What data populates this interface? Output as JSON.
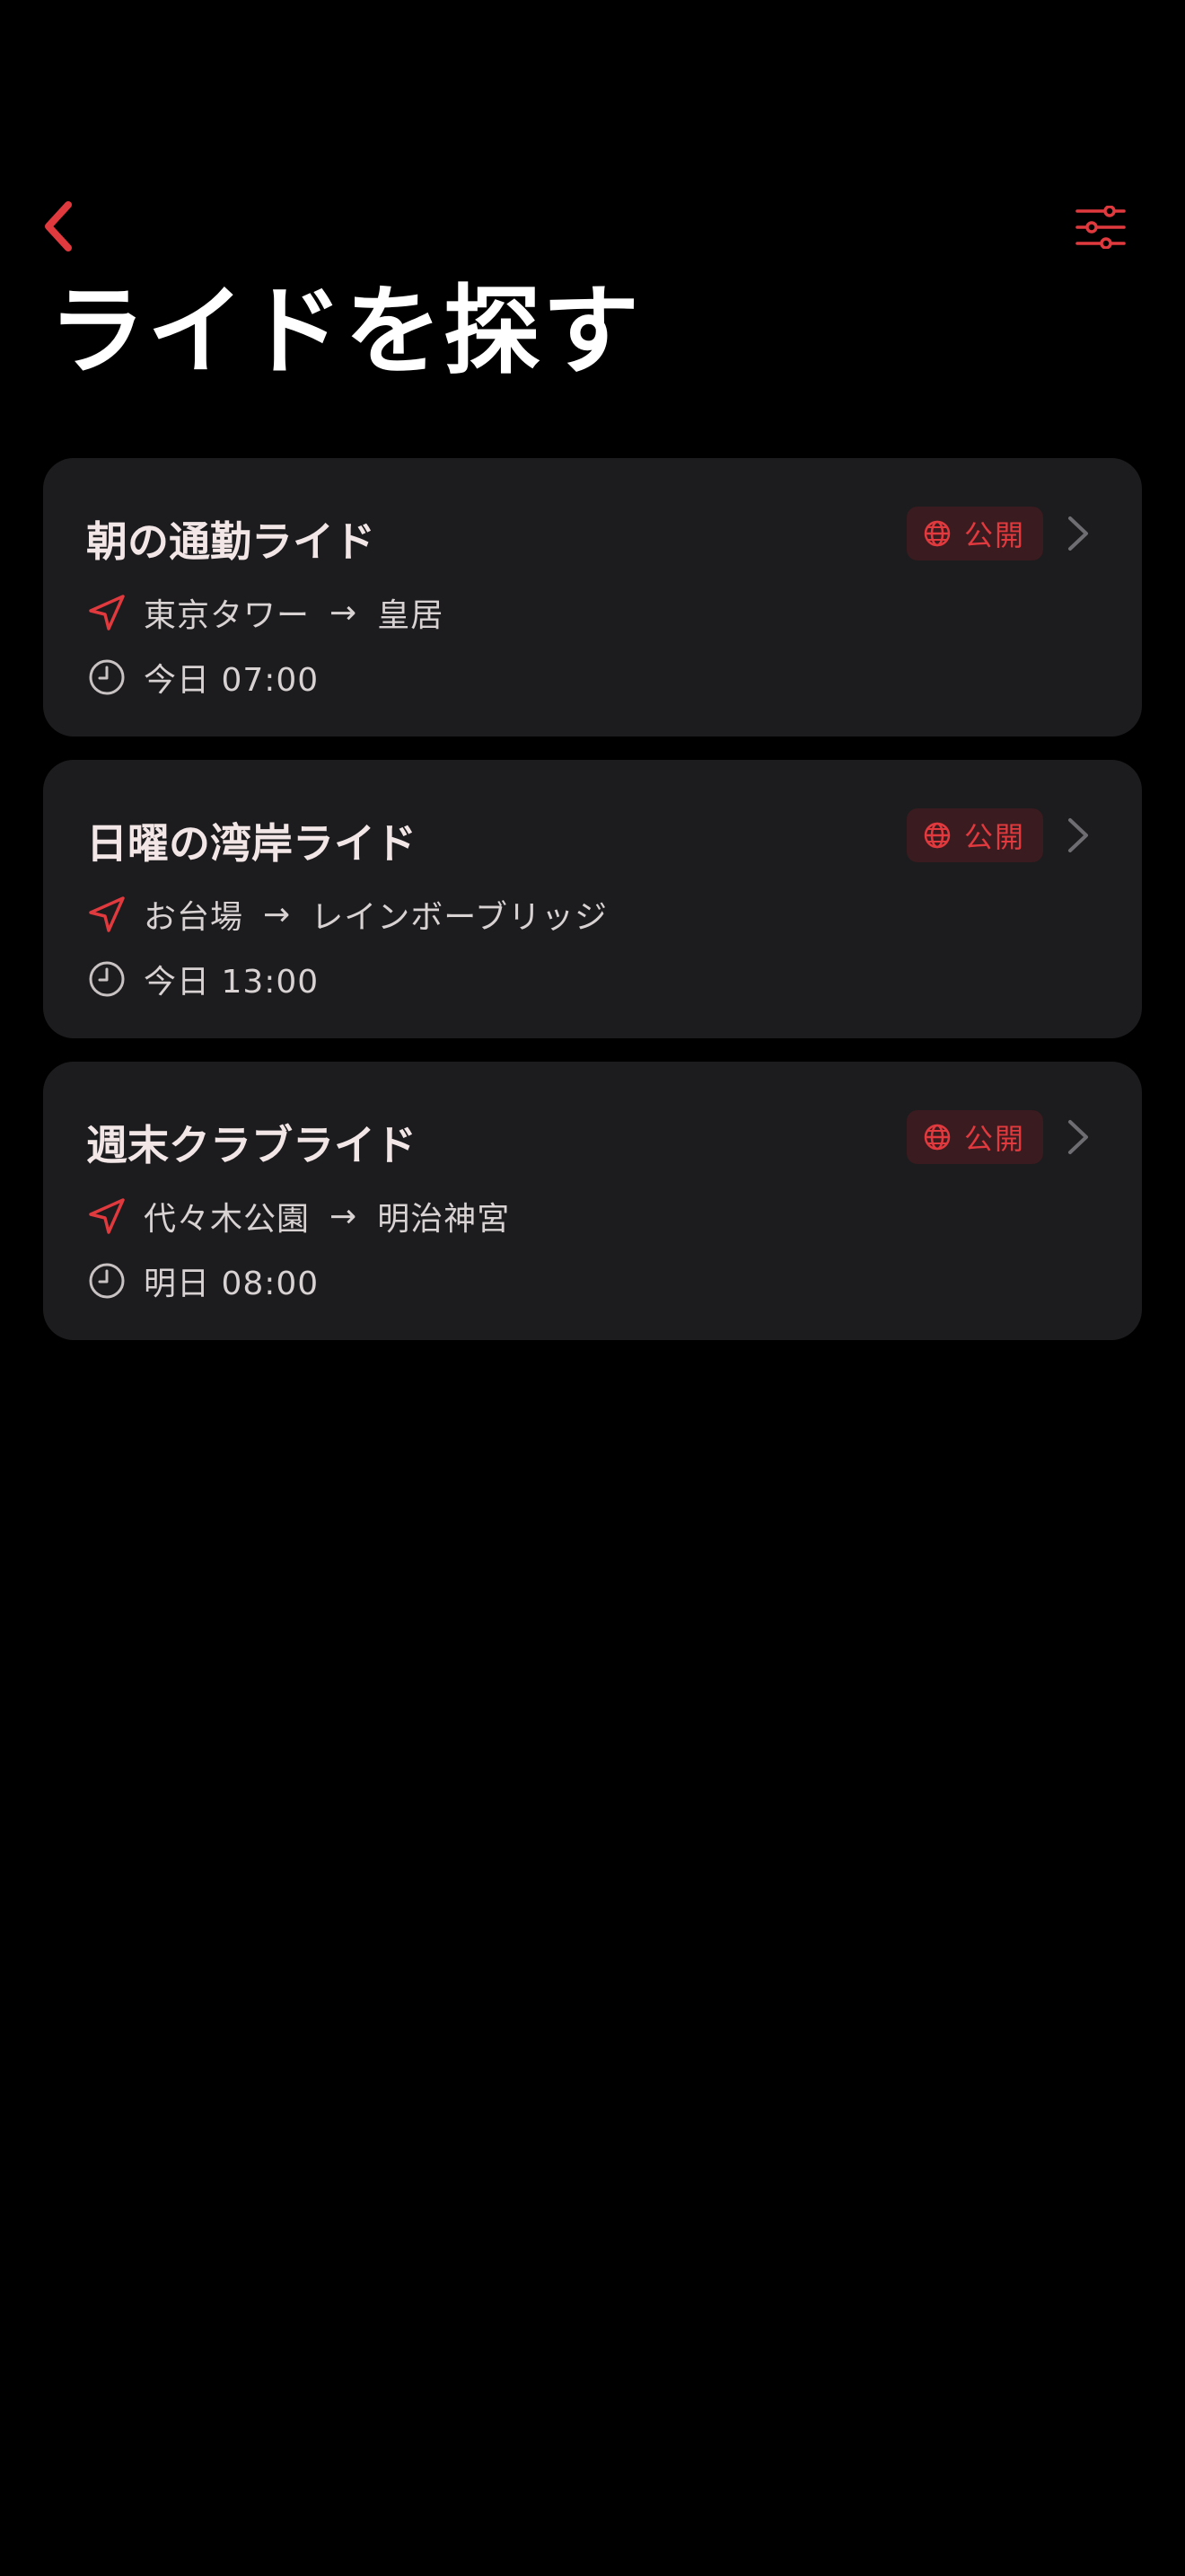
{
  "header": {
    "title": "ライドを探す"
  },
  "rides": [
    {
      "title": "朝の通勤ライド",
      "visibility": "公開",
      "from": "東京タワー",
      "to": "皇居",
      "arrow": "→",
      "time": "今日 07:00"
    },
    {
      "title": "日曜の湾岸ライド",
      "visibility": "公開",
      "from": "お台場",
      "to": "レインボーブリッジ",
      "arrow": "→",
      "time": "今日 13:00"
    },
    {
      "title": "週末クラブライド",
      "visibility": "公開",
      "from": "代々木公園",
      "to": "明治神宮",
      "arrow": "→",
      "time": "明日 08:00"
    }
  ],
  "icons": {
    "back": "chevron-left-icon",
    "filter": "sliders-icon",
    "globe": "globe-icon",
    "location": "location-arrow-icon",
    "clock": "clock-icon",
    "chevron": "chevron-right-icon"
  },
  "colors": {
    "accent": "#e0393e",
    "card_bg": "#1c1c1e",
    "badge_bg": "#3a1b1f",
    "background": "#000000"
  }
}
